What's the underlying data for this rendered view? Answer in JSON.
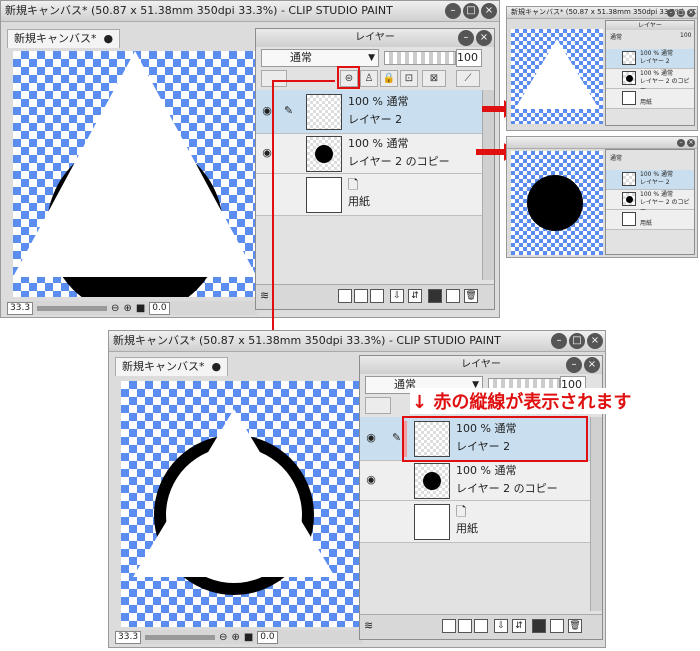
{
  "win1": {
    "title": "新規キャンバス* (50.87 x 51.38mm 350dpi 33.3%)  - CLIP STUDIO PAINT",
    "tab": "新規キャンバス*",
    "zoom": "33.3",
    "angle": "0.0"
  },
  "layer_panel_1": {
    "title": "レイヤー",
    "blend_mode": "通常",
    "opacity": "100",
    "layers": [
      {
        "line1": "100 %  通常",
        "line2": "レイヤー 2"
      },
      {
        "line1": "100 %  通常",
        "line2": "レイヤー 2 のコピー"
      },
      {
        "line1": "",
        "line2": "用紙"
      }
    ]
  },
  "win2": {
    "title": "新規キャンバス* (50.87 x 51.38mm 350dpi 33.3%)  - CLIP STUDIO PAINT",
    "tab": "新規キャンバス*",
    "zoom": "33.3",
    "angle": "0.0"
  },
  "layer_panel_2": {
    "title": "レイヤー",
    "blend_mode": "通常",
    "opacity": "100",
    "layers": [
      {
        "line1": "100 %  通常",
        "line2": "レイヤー 2"
      },
      {
        "line1": "100 %  通常",
        "line2": "レイヤー 2 のコピー"
      },
      {
        "line1": "",
        "line2": "用紙"
      }
    ]
  },
  "annotation": "↓ 赤の縦線が表示されます",
  "mini1": {
    "title": "新規キャンバス* (50.87 x 51.38mm 350dpi 33.3%)  - CLIP STUDIO PAINT",
    "panel_title": "レイヤー",
    "blend_mode": "通常",
    "opacity": "100",
    "layer1_line1": "100 % 通常",
    "layer1_line2": "レイヤー 2",
    "layer2_line1": "100 % 通常",
    "layer2_line2": "レイヤー 2 のコピー",
    "layer3": "用紙"
  },
  "mini2": {
    "blend_mode": "通常",
    "layer1_line1": "100 % 通常",
    "layer1_line2": "レイヤー 2",
    "layer2_line1": "100 % 通常",
    "layer2_line2": "レイヤー 2 のコピー",
    "layer3": "用紙"
  },
  "colors": {
    "accent_red": "#e01010",
    "checker_blue": "#5b8cf0",
    "selected_row": "#c9dff0"
  }
}
